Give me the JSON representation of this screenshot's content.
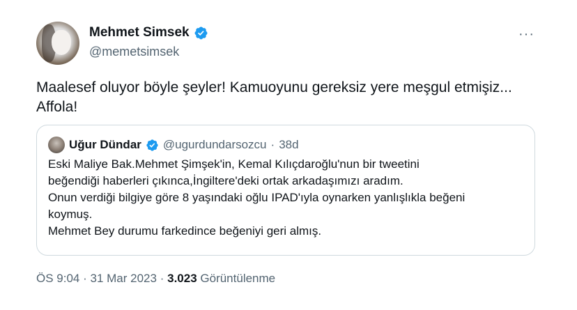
{
  "tweet": {
    "author_name": "Mehmet Simsek",
    "handle": "@memetsimsek",
    "text_lines": [
      "Maalesef oluyor böyle şeyler! Kamuoyunu gereksiz yere meşgul etmişiz...",
      "Affola!"
    ],
    "more_icon": "more-horizontal-icon"
  },
  "quote": {
    "author_name": "Uğur Dündar",
    "handle": "@ugurdundarsozcu",
    "separator": "·",
    "time": "38d",
    "lines": [
      "Eski Maliye Bak.Mehmet Şimşek'in, Kemal Kılıçdaroğlu'nun bir tweetini",
      "beğendiği haberleri çıkınca,İngiltere'deki ortak arkadaşımızı aradım.",
      "Onun verdiği bilgiye göre 8 yaşındaki oğlu IPAD'ıyla oynarken yanlışlıkla beğeni",
      "koymuş.",
      "Mehmet Bey durumu farkedince beğeniyi geri almış."
    ]
  },
  "meta": {
    "time": "ÖS 9:04",
    "sep1": "·",
    "date": "31 Mar 2023",
    "sep2": "·",
    "views_count": "3.023",
    "views_label": "Görüntülenme"
  },
  "colors": {
    "verified": "#1d9bf0",
    "secondary_text": "#536471",
    "border": "#cfd9de"
  }
}
